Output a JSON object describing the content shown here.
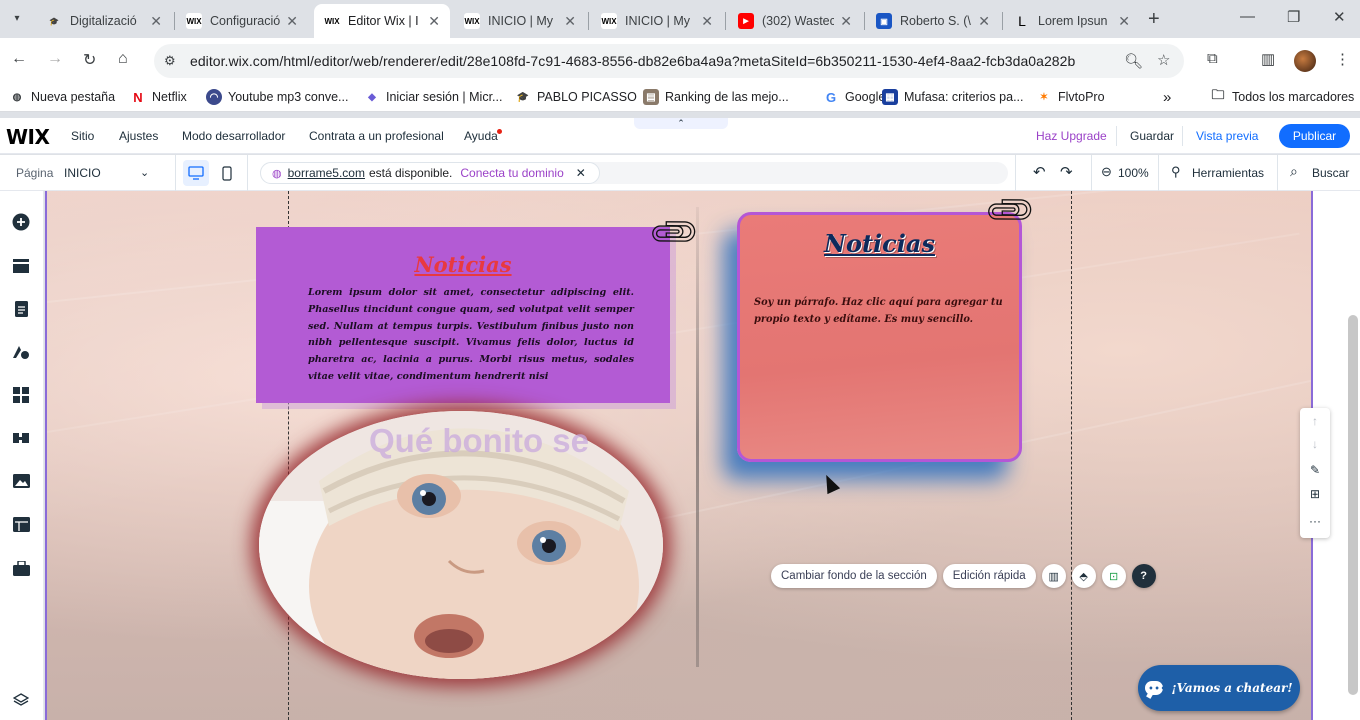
{
  "browser": {
    "tabs": [
      {
        "title": "Digitalizació",
        "favicon": "D",
        "active": false
      },
      {
        "title": "Configuració",
        "favicon": "wix",
        "active": false
      },
      {
        "title": "Editor Wix | I",
        "favicon": "wix",
        "active": true
      },
      {
        "title": "INICIO | My",
        "favicon": "wix",
        "active": false
      },
      {
        "title": "INICIO | My",
        "favicon": "wix",
        "active": false
      },
      {
        "title": "(302) Wastec",
        "favicon": "yt",
        "active": false
      },
      {
        "title": "Roberto S. (\\",
        "favicon": "clap",
        "active": false
      },
      {
        "title": "Lorem Ipsun",
        "favicon": "L",
        "active": false
      }
    ],
    "url": "editor.wix.com/html/editor/web/renderer/edit/28e108fd-7c91-4683-8556-db82e6ba4a9a?metaSiteId=6b350211-1530-4ef4-8aa2-fcb3da0a282b",
    "bookmarks": [
      {
        "label": "Nueva pestaña",
        "icon": "globe"
      },
      {
        "label": "Netflix",
        "icon": "netflix"
      },
      {
        "label": "Youtube mp3 conve...",
        "icon": "yt-mp3"
      },
      {
        "label": "Iniciar sesión | Micr...",
        "icon": "ms"
      },
      {
        "label": "PABLO PICASSO",
        "icon": "cap"
      },
      {
        "label": "Ranking de las mejo...",
        "icon": "rank"
      },
      {
        "label": "Google",
        "icon": "google"
      },
      {
        "label": "Mufasa: criterios pa...",
        "icon": "mufasa"
      },
      {
        "label": "FlvtoPro",
        "icon": "flvto"
      }
    ],
    "bookmarks_more": "»",
    "all_bookmarks": "Todos los marcadores"
  },
  "wix": {
    "logo": "WIX",
    "menu": [
      "Sitio",
      "Ajustes",
      "Modo desarrollador",
      "Contrata a un profesional",
      "Ayuda"
    ],
    "upgrade": "Haz Upgrade",
    "save": "Guardar",
    "preview": "Vista previa",
    "publish": "Publicar",
    "page_label": "Página",
    "page_value": "INICIO",
    "domain_name": "borrame5.com",
    "domain_text": "está disponible.",
    "domain_connect": "Conecta tu dominio",
    "zoom": "100%",
    "tools": "Herramientas",
    "search": "Buscar",
    "accent_color": "#116dff"
  },
  "canvas": {
    "news_left": {
      "title": "Noticias",
      "text": "Lorem ipsum dolor sit amet, consectetur adipiscing elit. Phasellus tincidunt congue quam, sed volutpat velit semper sed. Nullam at tempus turpis. Vestibulum finibus justo non nibh pellentesque suscipit. Vivamus felis dolor, luctus id pharetra ac, lacinia a purus. Morbi risus metus, sodales vitae velit vitae, condimentum hendrerit nisi"
    },
    "news_right": {
      "title": "Noticias",
      "text": "Soy un párrafo. Haz clic aquí para agregar tu propio texto y edítame. Es muy sencillo."
    },
    "photo_caption": "Qué bonito se",
    "section_actions": {
      "change_bg": "Cambiar fondo de la sección",
      "quick_edit": "Edición rápida"
    },
    "chat": "¡Vamos a chatear!"
  }
}
